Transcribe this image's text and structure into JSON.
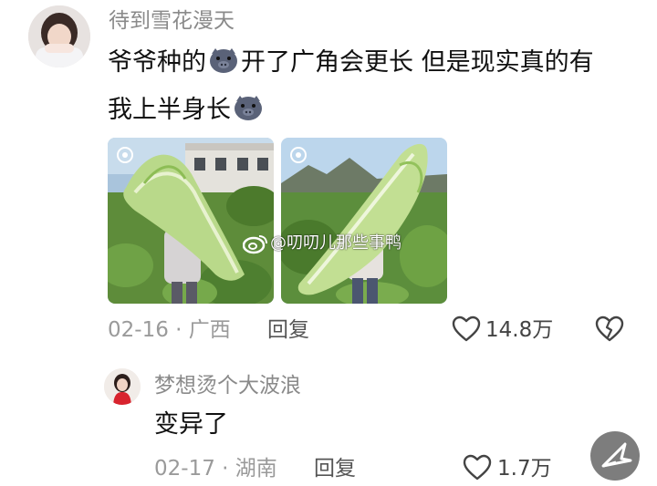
{
  "comment1": {
    "username": "待到雪花漫天",
    "content_line1_part1": "爷爷种的",
    "content_line1_part2": "开了广角会更长  但是现实真的有",
    "content_line2_part1": "我上半身长",
    "date": "02-16",
    "location": "广西",
    "reply_label": "回复",
    "like_count": "14.8万",
    "emoji_icon": "pig-face-emoji-icon"
  },
  "watermark": {
    "text": "@叨叨儿那些事鸭"
  },
  "comment2": {
    "username": "梦想烫个大波浪",
    "content": "变异了",
    "date": "02-17",
    "location": "湖南",
    "reply_label": "回复",
    "like_count": "1.7万"
  },
  "colors": {
    "username": "#8a8a8a",
    "meta": "#9a9a9a",
    "fab": "#7d7d7d"
  }
}
